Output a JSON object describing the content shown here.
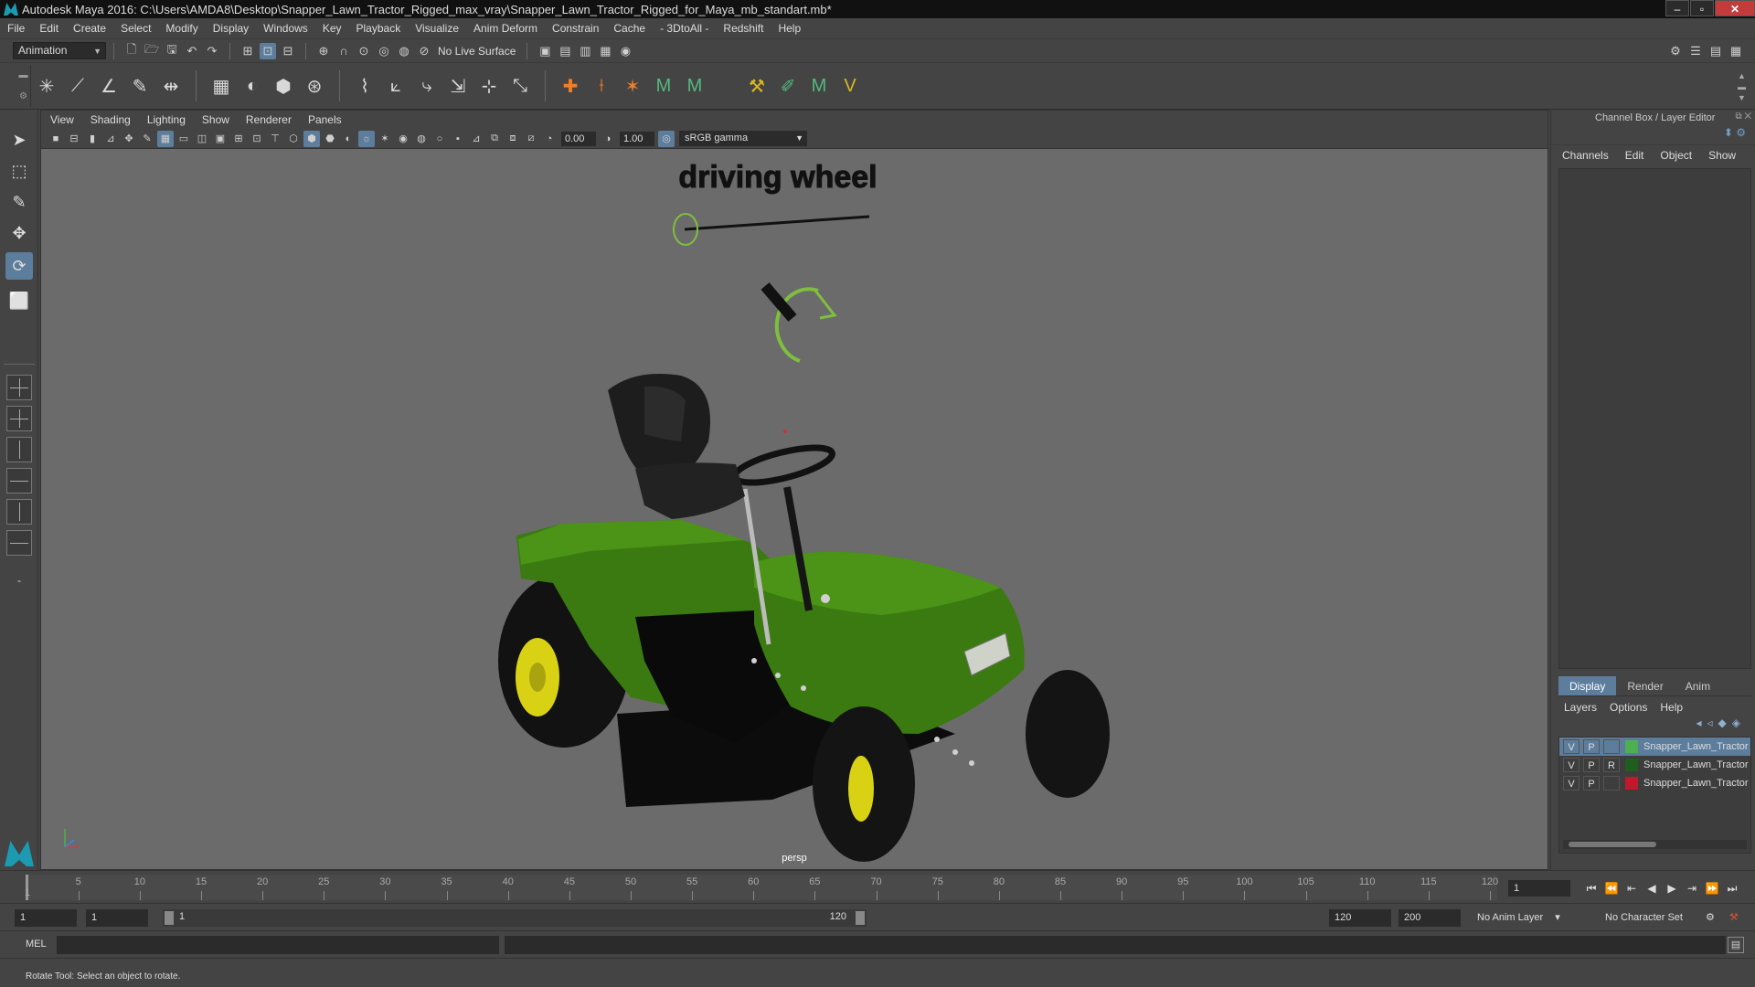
{
  "window": {
    "title": "Autodesk Maya 2016: C:\\Users\\AMDA8\\Desktop\\Snapper_Lawn_Tractor_Rigged_max_vray\\Snapper_Lawn_Tractor_Rigged_for_Maya_mb_standart.mb*",
    "minimize": "–",
    "maximize": "▫",
    "close": "✕"
  },
  "menubar": [
    "File",
    "Edit",
    "Create",
    "Select",
    "Modify",
    "Display",
    "Windows",
    "Key",
    "Playback",
    "Visualize",
    "Anim Deform",
    "Constrain",
    "Cache",
    "- 3DtoAll -",
    "Redshift",
    "Help"
  ],
  "statusline": {
    "mode": "Animation",
    "live_surface": "No Live Surface"
  },
  "viewport": {
    "panel_menu": [
      "View",
      "Shading",
      "Lighting",
      "Show",
      "Renderer",
      "Panels"
    ],
    "exposure": "0.00",
    "gamma": "1.00",
    "color_space": "sRGB gamma",
    "scene_label": "driving wheel",
    "camera": "persp",
    "colors": {
      "background": "#6b6b6b",
      "body_green": "#3a7a10",
      "wheel_yellow": "#d9d214",
      "controller_green": "#7fbf3f"
    }
  },
  "channel_box": {
    "title": "Channel Box / Layer Editor",
    "menu": [
      "Channels",
      "Edit",
      "Object",
      "Show"
    ]
  },
  "layer_editor": {
    "tabs": [
      "Display",
      "Render",
      "Anim"
    ],
    "active_tab": "Display",
    "menu": [
      "Layers",
      "Options",
      "Help"
    ],
    "layers": [
      {
        "v": "V",
        "p": "P",
        "r": "",
        "color": "#4caf50",
        "name": "Snapper_Lawn_Tractor",
        "selected": true
      },
      {
        "v": "V",
        "p": "P",
        "r": "R",
        "color": "#1f5e1f",
        "name": "Snapper_Lawn_Tractor",
        "selected": false
      },
      {
        "v": "V",
        "p": "P",
        "r": "",
        "color": "#c2182b",
        "name": "Snapper_Lawn_Tractor",
        "selected": false
      }
    ]
  },
  "time_slider": {
    "ticks": [
      "5",
      "10",
      "15",
      "20",
      "25",
      "30",
      "35",
      "40",
      "45",
      "50",
      "55",
      "60",
      "65",
      "70",
      "75",
      "80",
      "85",
      "90",
      "95",
      "100",
      "105",
      "110",
      "115",
      "120"
    ],
    "first_frame_label": "1",
    "current_frame": "1"
  },
  "range_slider": {
    "start_time": "1",
    "playback_start": "1",
    "range_start_label": "1",
    "range_end_label": "120",
    "playback_end": "120",
    "end_time": "200",
    "anim_layer": "No Anim Layer",
    "character_set": "No Character Set"
  },
  "command_line": {
    "label": "MEL"
  },
  "help_line": {
    "text": "Rotate Tool: Select an object to rotate."
  }
}
